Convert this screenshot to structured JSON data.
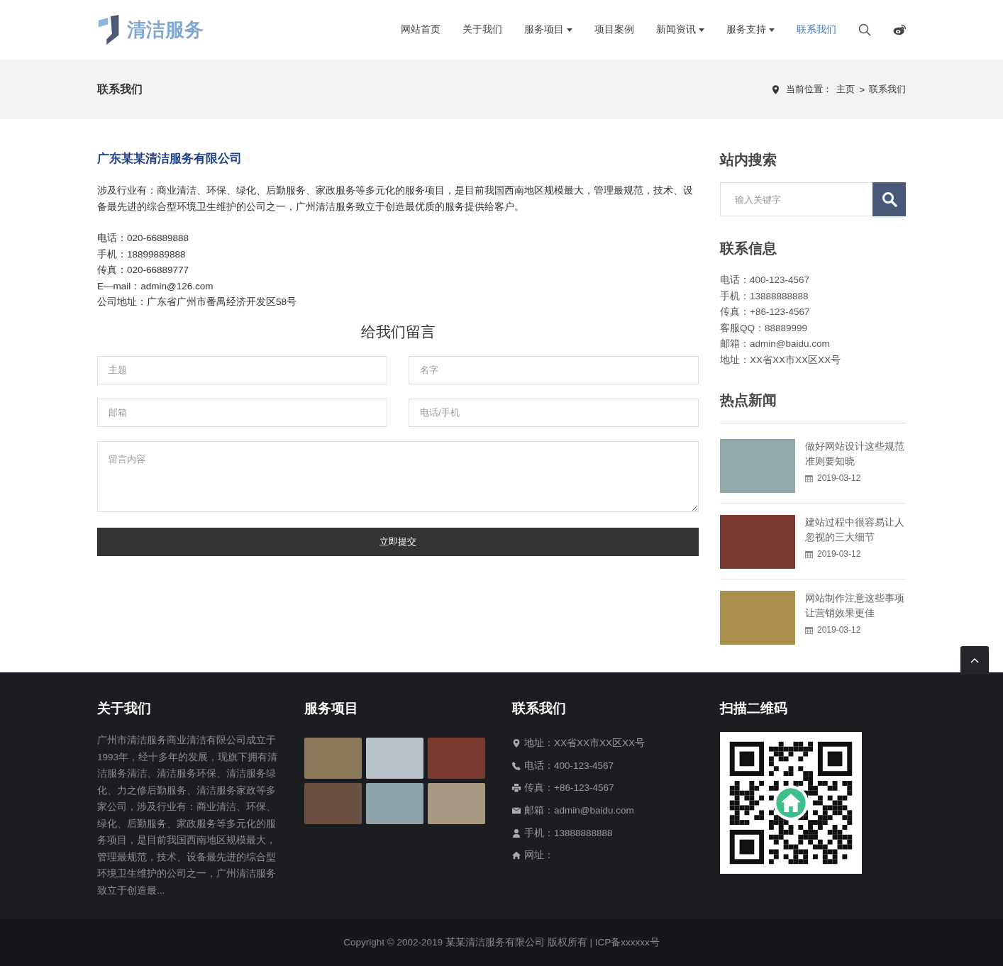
{
  "header": {
    "logo_text": "清洁服务",
    "nav": [
      {
        "label": "网站首页",
        "selected": false,
        "dropdown": false
      },
      {
        "label": "关于我们",
        "selected": false,
        "dropdown": false
      },
      {
        "label": "服务项目",
        "selected": false,
        "dropdown": true
      },
      {
        "label": "项目案例",
        "selected": false,
        "dropdown": false
      },
      {
        "label": "新闻资讯",
        "selected": false,
        "dropdown": true
      },
      {
        "label": "服务支持",
        "selected": false,
        "dropdown": true
      },
      {
        "label": "联系我们",
        "selected": true,
        "dropdown": false
      }
    ]
  },
  "page_banner": {
    "title": "联系我们",
    "breadcrumb_label": "当前位置：",
    "breadcrumb": [
      "主页",
      "联系我们"
    ],
    "separator": ">"
  },
  "contact": {
    "company": "广东某某清洁服务有限公司",
    "intro": "涉及行业有：商业清洁、环保、绿化、后勤服务、家政服务等多元化的服务项目，是目前我国西南地区规模最大，管理最规范，技术、设备最先进的综合型环境卫生维护的公司之一，广州清洁服务致立于创造最优质的服务提供给客户。",
    "lines": [
      "电话：020-66889888",
      "手机：18899889888",
      "传真：020-66889777",
      "E—mail：admin@126.com",
      "公司地址：广东省广州市番禺经济开发区58号"
    ]
  },
  "message_form": {
    "title": "给我们留言",
    "fields": [
      {
        "placeholder": "主题"
      },
      {
        "placeholder": "名字"
      },
      {
        "placeholder": "邮箱"
      },
      {
        "placeholder": "电话/手机"
      }
    ],
    "message_placeholder": "留言内容",
    "submit": "立即提交"
  },
  "sidebar": {
    "search_title": "站内搜索",
    "search_placeholder": "输入关键字",
    "info_title": "联系信息",
    "info_lines": [
      "电话：400-123-4567",
      "手机：13888888888",
      "传真：+86-123-4567",
      "客服QQ：88889999",
      "邮箱：admin@baidu.com",
      "地址：XX省XX市XX区XX号"
    ],
    "news_title": "热点新闻",
    "news": [
      {
        "title": "做好网站设计这些规范准则要知晓",
        "date": "2019-03-12"
      },
      {
        "title": "建站过程中很容易让人忽视的三大细节",
        "date": "2019-03-12"
      },
      {
        "title": "网站制作注意这些事项让营销效果更佳",
        "date": "2019-03-12"
      }
    ]
  },
  "footer": {
    "about_title": "关于我们",
    "about_text": "广州市清洁服务商业清洁有限公司成立于1993年，经十多年的发展，现旗下拥有清洁服务清洁、清洁服务环保、清洁服务绿化、力之修后勤服务、清洁服务家政等多家公司，涉及行业有：商业清洁、环保、绿化、后勤服务、家政服务等多元化的服务项目，是目前我国西南地区规模最大，管理最规范，技术、设备最先进的综合型环境卫生维护的公司之一，广州清洁服务致立于创造最...",
    "services_title": "服务项目",
    "contact_title": "联系我们",
    "contact_lines": [
      "地址：XX省XX市XX区XX号",
      "电话：400-123-4567",
      "传真：+86-123-4567",
      "邮箱：admin@baidu.com",
      "手机：13888888888",
      "网址："
    ],
    "qr_title": "扫描二维码"
  },
  "copyright": "Copyright © 2002-2019 某某清洁服务有限公司 版权所有 | ICP备xxxxxx号"
}
